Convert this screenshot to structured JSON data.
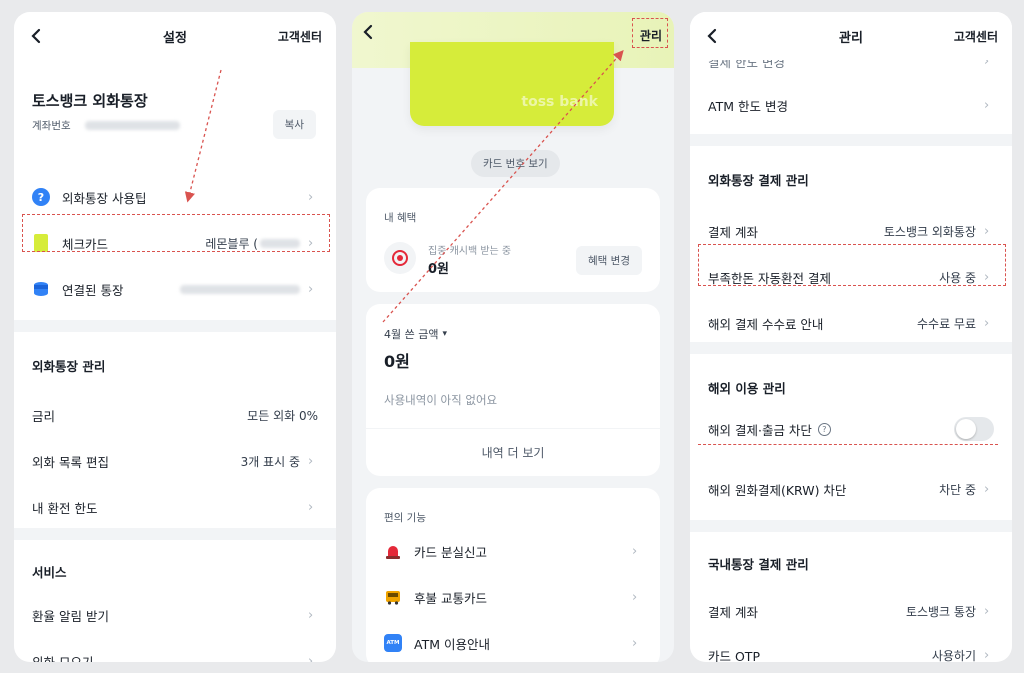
{
  "screen1": {
    "header": {
      "title": "설정",
      "right": "고객센터"
    },
    "account": {
      "name": "토스뱅크 외화통장",
      "number_label": "계좌번호",
      "copy": "복사"
    },
    "rows": [
      {
        "label": "외화통장 사용팁",
        "icon": "question-circle-icon"
      },
      {
        "label": "체크카드",
        "value": "레몬블루 (",
        "icon": "card-icon"
      },
      {
        "label": "연결된 통장",
        "icon": "coin-stack-icon"
      }
    ],
    "mgmt": {
      "title": "외화통장 관리",
      "rows": [
        {
          "label": "금리",
          "value": "모든 외화 0%"
        },
        {
          "label": "외화 목록 편집",
          "value": "3개 표시 중"
        },
        {
          "label": "내 환전 한도",
          "value": ""
        }
      ]
    },
    "service": {
      "title": "서비스",
      "rows": [
        {
          "label": "환율 알림 받기"
        },
        {
          "label": "외화 모으기"
        }
      ]
    }
  },
  "screen2": {
    "header": {
      "right": "관리"
    },
    "card_brand": "toss bank",
    "card_number_btn": "카드 번호 보기",
    "benefit": {
      "title": "내 혜택",
      "sub": "집중 캐시백 받는 중",
      "amount": "0원",
      "button": "혜택 변경"
    },
    "spending": {
      "month": "4월 쓴 금액",
      "amount": "0원",
      "empty": "사용내역이 아직 없어요",
      "more": "내역 더 보기"
    },
    "features": {
      "title": "편의 기능",
      "items": [
        {
          "label": "카드 분실신고",
          "icon": "siren-icon"
        },
        {
          "label": "후불 교통카드",
          "icon": "bus-icon"
        },
        {
          "label": "ATM 이용안내",
          "icon": "atm-icon",
          "icon_text": "ATM"
        }
      ]
    }
  },
  "screen3": {
    "header": {
      "title": "관리",
      "right": "고객센터"
    },
    "top_rows": [
      {
        "label": "결제 한도 변경"
      },
      {
        "label": "ATM 한도 변경"
      }
    ],
    "payment": {
      "title": "외화통장 결제 관리",
      "rows": [
        {
          "label": "결제 계좌",
          "value": "토스뱅크 외화통장"
        },
        {
          "label": "부족한돈 자동환전 결제",
          "value": "사용 중"
        },
        {
          "label": "해외 결제 수수료 안내",
          "value": "수수료 무료"
        }
      ]
    },
    "overseas": {
      "title": "해외 이용 관리",
      "rows": [
        {
          "label": "해외 결제·출금 차단",
          "info": "?"
        },
        {
          "label": "해외 원화결제(KRW) 차단",
          "value": "차단 중"
        }
      ]
    },
    "domestic": {
      "title": "국내통장 결제 관리",
      "rows": [
        {
          "label": "결제 계좌",
          "value": "토스뱅크 통장"
        },
        {
          "label": "카드 OTP",
          "value": "사용하기"
        }
      ]
    }
  },
  "common": {
    "chevron": "›",
    "back": "‹"
  },
  "colors": {
    "lime": "#d6ec3a",
    "annotation_red": "#d9534f",
    "blue_icon": "#3182f6"
  }
}
